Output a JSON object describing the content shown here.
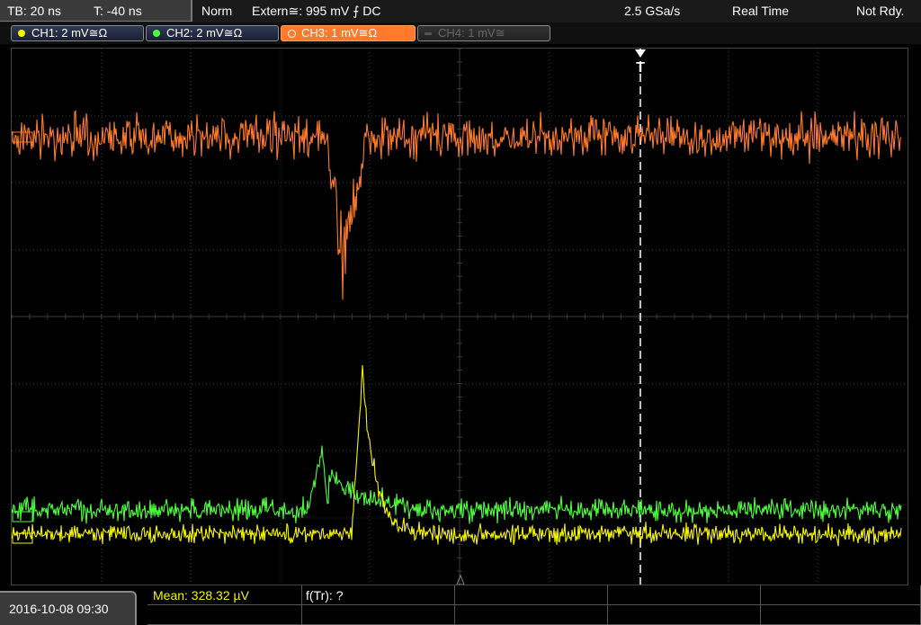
{
  "header": {
    "timebase": "TB: 20 ns",
    "trigger_time": "T: -40 ns",
    "mode": "Norm",
    "trigger_source": "Extern≅: 995 mV ⨍ DC",
    "sample_rate": "2.5 GSa/s",
    "acq_mode": "Real Time",
    "status": "Not Rdy."
  },
  "channels": [
    {
      "label": "CH1: 2 mV≅Ω",
      "color": "#f5f500",
      "state": "on"
    },
    {
      "label": "CH2: 2 mV≅Ω",
      "color": "#4cff3a",
      "state": "on"
    },
    {
      "label": "CH3: 1 mV≅Ω",
      "color": "#ff7a2a",
      "state": "selected"
    },
    {
      "label": "CH4: 1 mV≅",
      "color": "#666666",
      "state": "off"
    }
  ],
  "trigger_marker": "T",
  "footer": {
    "datetime": "2016-10-08 09:30",
    "measurement_mean": "Mean: 328.32 µV",
    "measurement_ftr": "f(Tr): ?"
  },
  "colors": {
    "ch1": "#f5f500",
    "ch2": "#4cff3a",
    "ch3": "#ff7a2a",
    "grid": "#3a3a3a"
  }
}
